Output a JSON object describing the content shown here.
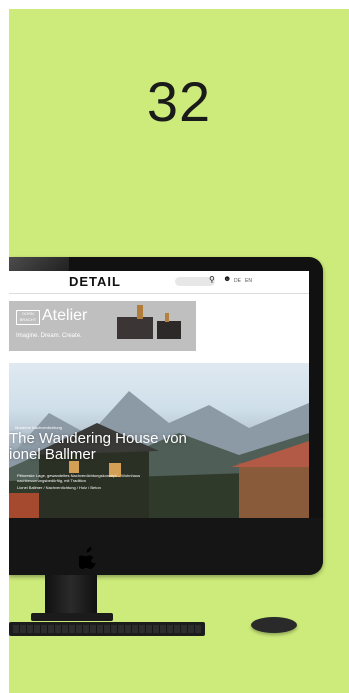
{
  "page_number": "32",
  "site": {
    "logo": "DETAIL",
    "lang_de": "DE",
    "lang_en": "EN"
  },
  "banner": {
    "badge": "DORN BRACHT",
    "title": "Atelier",
    "tagline": "Imagine. Dream. Create."
  },
  "hero": {
    "kicker": "Moderne Nachverdichtung",
    "title_line1": "The Wandering House von",
    "title_line2": "ionel Ballmer",
    "description": "Pittoreske Lage, gewandeltes Nachverdichtungskonzept – Wohnhaus nachbesserungsbedürftig, mit Tradition",
    "meta": "Lionel Ballmer / Nachverdichtung / Holz / Beton"
  },
  "colors": {
    "background": "#cdeb7b",
    "device": "#111111"
  }
}
